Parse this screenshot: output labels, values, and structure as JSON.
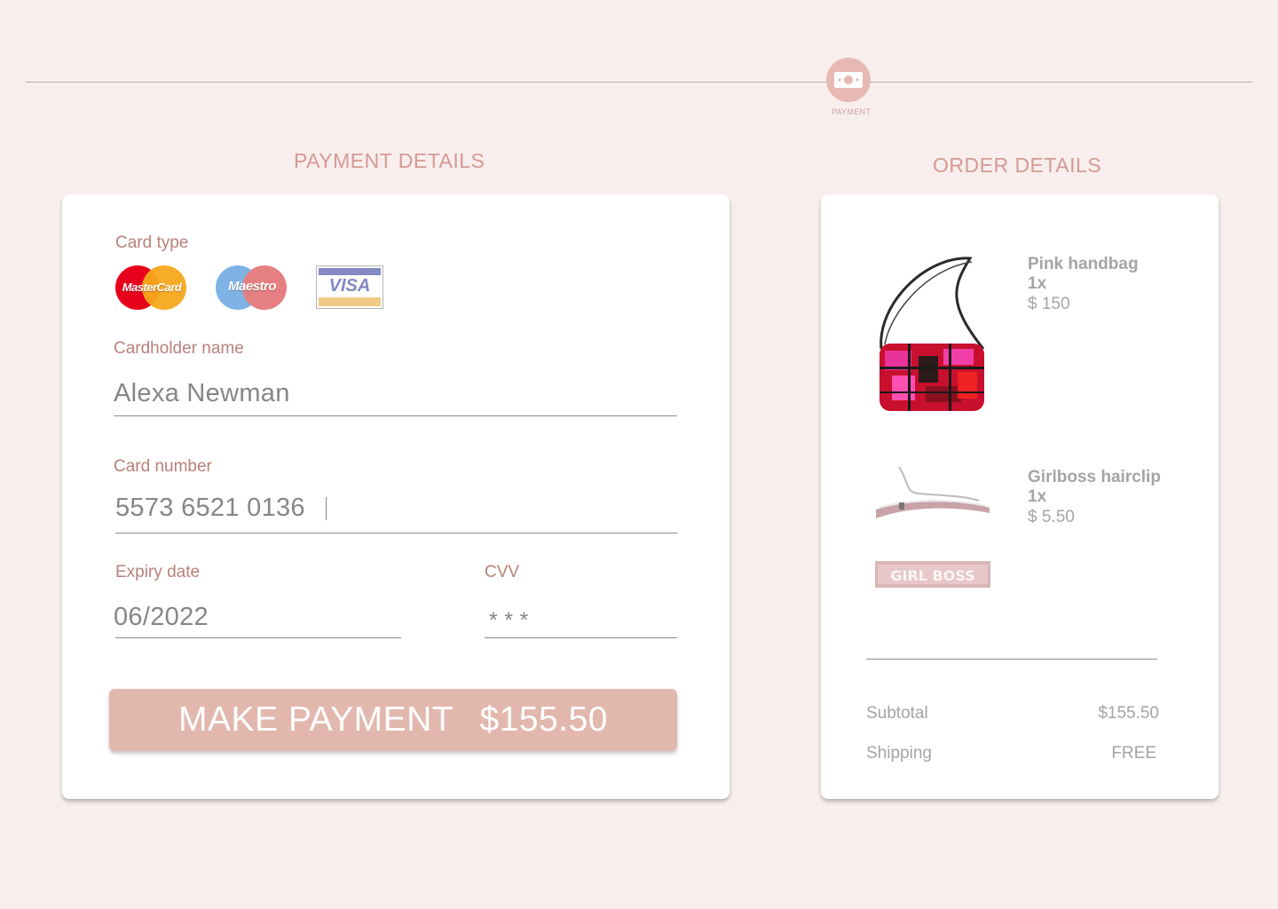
{
  "stepper": {
    "step_label": "PAYMENT",
    "icon": "banknote-icon"
  },
  "payment": {
    "title": "PAYMENT DETAILS",
    "card_type_label": "Card type",
    "card_types": [
      {
        "name": "MasterCard",
        "icon": "mastercard-logo"
      },
      {
        "name": "Maestro",
        "icon": "maestro-logo"
      },
      {
        "name": "VISA",
        "icon": "visa-logo"
      }
    ],
    "cardholder_label": "Cardholder name",
    "cardholder_value": "Alexa Newman",
    "card_number_label": "Card number",
    "card_number_value": "5573 6521 0136",
    "expiry_label": "Expiry date",
    "expiry_value": "06/2022",
    "cvv_label": "CVV",
    "cvv_value": "* * *",
    "button_label": "MAKE PAYMENT",
    "button_amount": "$155.50"
  },
  "order": {
    "title": "ORDER DETAILS",
    "items": [
      {
        "name": "Pink handbag",
        "qty": "1x",
        "price": "$ 150",
        "image": "handbag-image"
      },
      {
        "name": "Girlboss hairclip",
        "qty": "1x",
        "price": "$ 5.50",
        "image": "hairclip-image"
      }
    ],
    "subtotal_label": "Subtotal",
    "subtotal_value": "$155.50",
    "shipping_label": "Shipping",
    "shipping_value": "FREE"
  },
  "colors": {
    "background": "#f8eeed",
    "accent": "#d49a93",
    "button": "#e2b8ae",
    "label": "#b8817b"
  }
}
